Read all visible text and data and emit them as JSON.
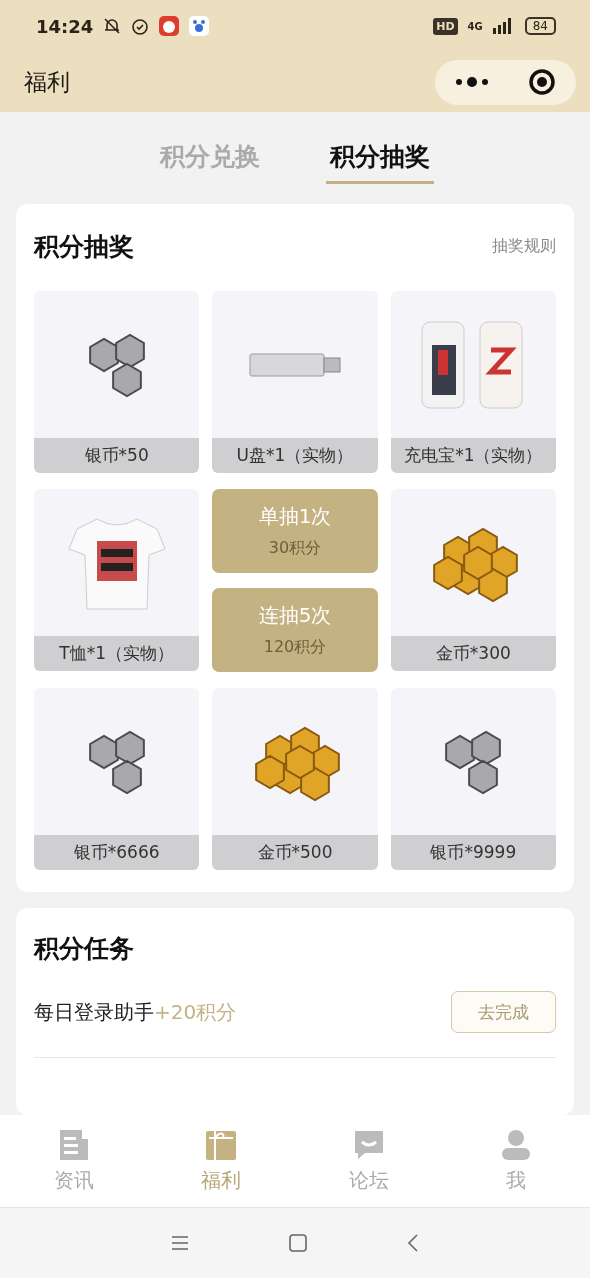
{
  "status_bar": {
    "time": "14:24",
    "hd": "HD",
    "network": "4G",
    "battery": "84"
  },
  "header": {
    "title": "福利"
  },
  "tabs": [
    {
      "label": "积分兑换",
      "selected": false
    },
    {
      "label": "积分抽奖",
      "selected": true
    }
  ],
  "lottery": {
    "title": "积分抽奖",
    "rules_link": "抽奖规则",
    "prizes": [
      {
        "kind": "silver",
        "label": "银币*50"
      },
      {
        "kind": "usb",
        "label": "U盘*1（实物）"
      },
      {
        "kind": "powerbank",
        "label": "充电宝*1（实物）"
      },
      {
        "kind": "tshirt",
        "label": "T恤*1（实物）"
      },
      {
        "kind": "gold",
        "label": "金币*300"
      },
      {
        "kind": "silver",
        "label": "银币*6666"
      },
      {
        "kind": "gold",
        "label": "金币*500"
      },
      {
        "kind": "silver",
        "label": "银币*9999"
      }
    ],
    "draws": [
      {
        "label": "单抽1次",
        "cost": "30积分"
      },
      {
        "label": "连抽5次",
        "cost": "120积分"
      }
    ]
  },
  "tasks": {
    "title": "积分任务",
    "items": [
      {
        "name": "每日登录助手",
        "reward": "+20积分",
        "button": "去完成"
      }
    ]
  },
  "bottom_nav": [
    {
      "kind": "news",
      "label": "资讯",
      "selected": false
    },
    {
      "kind": "gift",
      "label": "福利",
      "selected": true
    },
    {
      "kind": "forum",
      "label": "论坛",
      "selected": false
    },
    {
      "kind": "me",
      "label": "我",
      "selected": false
    }
  ]
}
